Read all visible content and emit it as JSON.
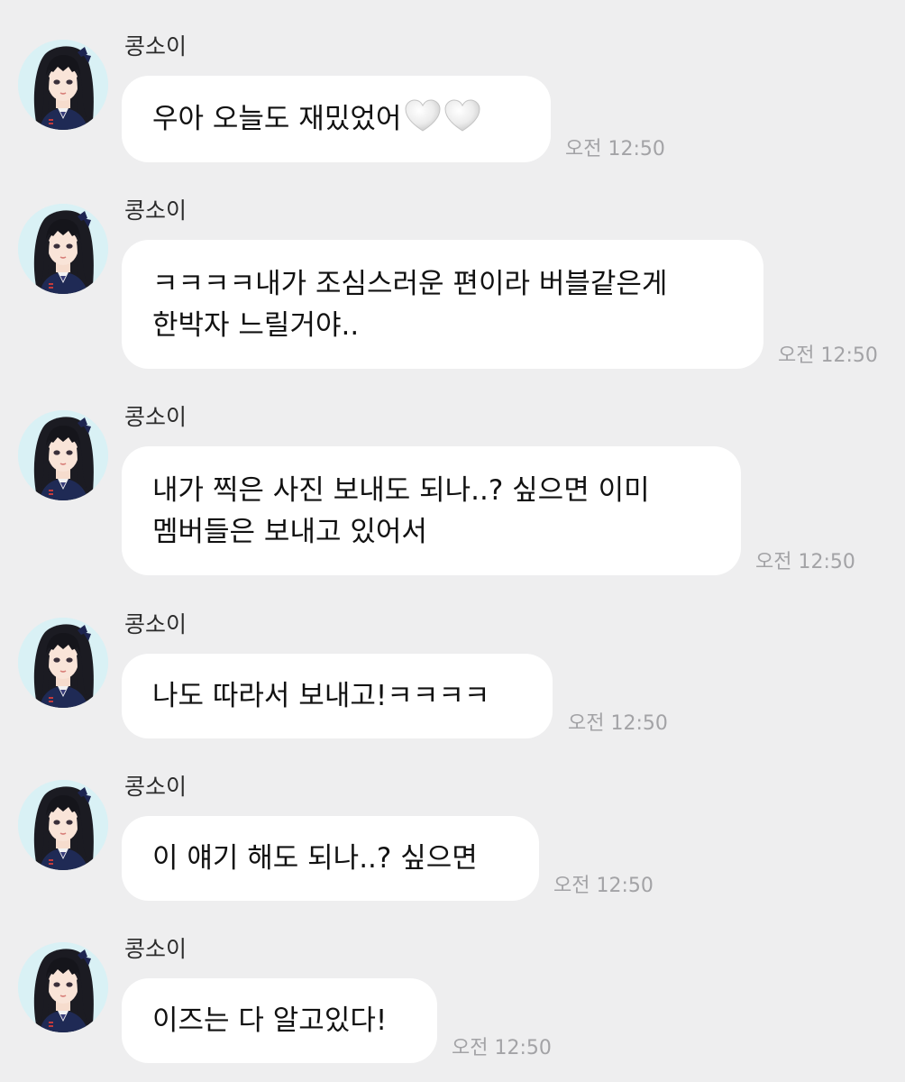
{
  "chat": {
    "messages": [
      {
        "sender": "콩소이",
        "lines": [
          "우아 오늘도 재밌었어"
        ],
        "emoji": [
          "white-heart",
          "white-heart"
        ],
        "time": "오전 12:50"
      },
      {
        "sender": "콩소이",
        "lines": [
          "ㅋㅋㅋㅋ내가 조심스러운 편이라 버블같은게",
          "한박자 느릴거야.."
        ],
        "time": "오전 12:50"
      },
      {
        "sender": "콩소이",
        "lines": [
          "내가 찍은 사진 보내도 되나..? 싶으면 이미",
          "멤버들은 보내고 있어서"
        ],
        "time": "오전 12:50"
      },
      {
        "sender": "콩소이",
        "lines": [
          "나도 따라서 보내고!ㅋㅋㅋㅋ"
        ],
        "time": "오전 12:50"
      },
      {
        "sender": "콩소이",
        "lines": [
          "이 얘기 해도 되나..? 싶으면"
        ],
        "time": "오전 12:50"
      },
      {
        "sender": "콩소이",
        "lines": [
          "이즈는 다 알고있다!"
        ],
        "time": "오전 12:50"
      }
    ]
  }
}
